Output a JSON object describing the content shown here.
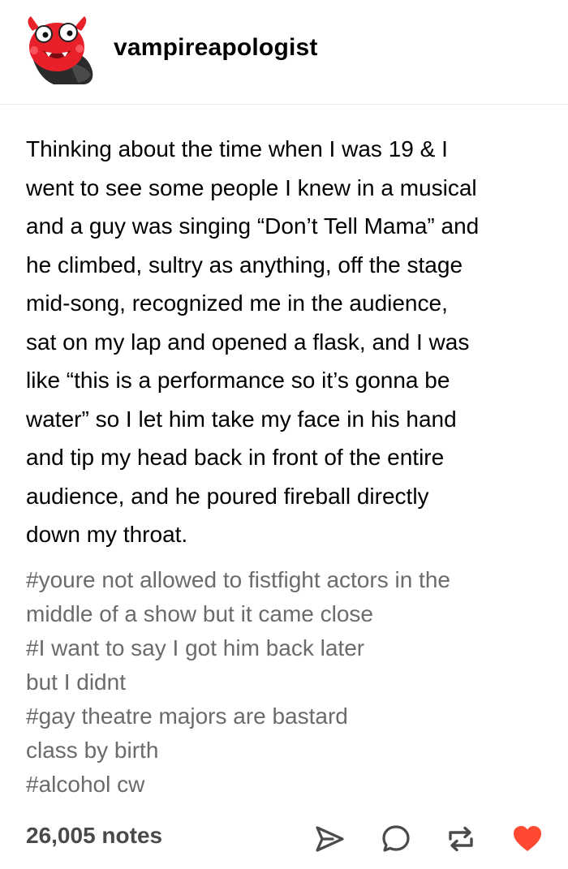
{
  "post": {
    "username": "vampireapologist",
    "body_lines": [
      "Thinking about the time when I was 19 & I",
      "went to see some people I knew in a musical",
      "and a guy was singing “Don’t Tell Mama” and",
      "he climbed, sultry as anything, off the stage",
      "mid-song, recognized me in the audience,",
      "sat on my lap and opened a flask, and I was",
      "like “this is a performance so it’s gonna be",
      "water” so I let him take my face in his hand",
      "and tip my head back in front of the entire",
      "audience, and he poured fireball directly",
      "down my throat."
    ],
    "tag_lines": [
      "#youre not allowed to fistfight actors in the",
      "middle of a show but it came close",
      "#I want to say I got him back later",
      "but I didnt",
      "#gay theatre majors are bastard",
      "class by birth",
      "#alcohol cw"
    ]
  },
  "footer": {
    "notes": "26,005 notes",
    "actions": {
      "share_icon": "share-icon",
      "reply_icon": "reply-icon",
      "reblog_icon": "reblog-icon",
      "like_icon": "heart-icon"
    },
    "like_color": "#ff4930",
    "icon_color": "#4a4a4a"
  },
  "colors": {
    "text": "#000000",
    "tags": "#6b6b6b",
    "divider": "#ececec",
    "avatar_primary": "#e8202a",
    "avatar_cape": "#2b2b2b"
  }
}
